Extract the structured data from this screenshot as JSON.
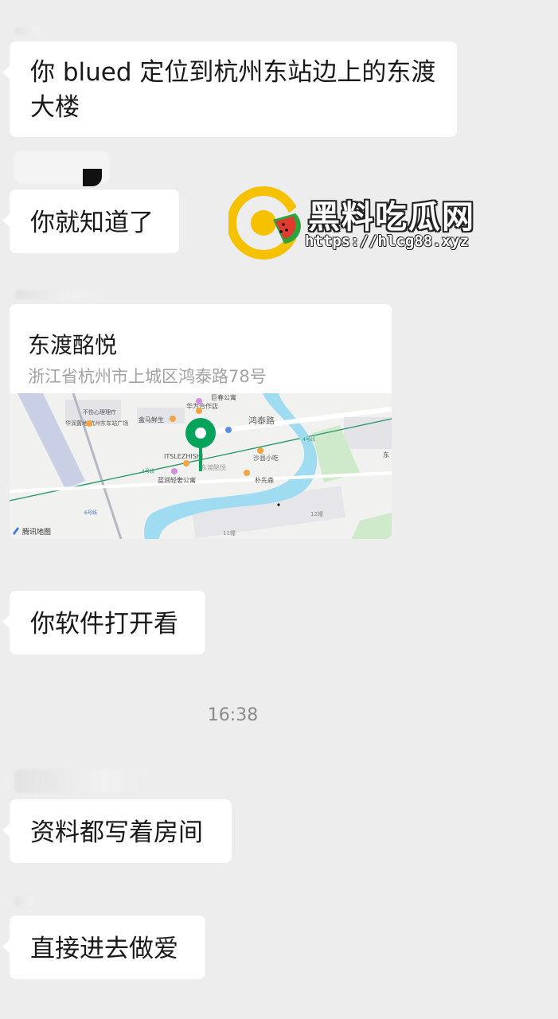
{
  "messages": [
    {
      "text": "你 blued 定位到杭州东站边上的东渡大楼"
    },
    {
      "text": "你就知道了"
    },
    {
      "text": "你软件打开看"
    },
    {
      "text": "资料都写着房间"
    },
    {
      "text": "直接进去做爱"
    }
  ],
  "location": {
    "title": "东渡酩悦",
    "address": "浙江省杭州市上城区鸿泰路78号",
    "map": {
      "provider": "腾讯地图",
      "labels": {
        "road": "鸿泰路",
        "poi_huawei": "华为合作店",
        "poi_juchun": "巨春公寓",
        "poi_shengxian": "盒马鲜生",
        "poi_shaxian": "沙县小吃",
        "poi_puxian": "朴先森",
        "poi_lanjian": "蓝涧轻奢公寓",
        "poi_its": "ITSLEZHISHI",
        "poi_dongdu": "东渡酩悦",
        "poi_station": "华润置地·杭州东车站广场",
        "poi_xinli": "不伤心理理疗",
        "block_12": "12幢",
        "block_11": "11幢",
        "line4a": "4号线",
        "line4b": "4号线",
        "line6": "6号线",
        "edge_dong": "东"
      }
    }
  },
  "timestamp": "16:38",
  "watermark": {
    "title": "黑料吃瓜网",
    "url": "https://hlcg88.xyz"
  },
  "colors": {
    "background": "#ededed",
    "bubble": "#ffffff",
    "text": "#191919",
    "pin": "#07a35a",
    "river": "#9fdcf2"
  }
}
